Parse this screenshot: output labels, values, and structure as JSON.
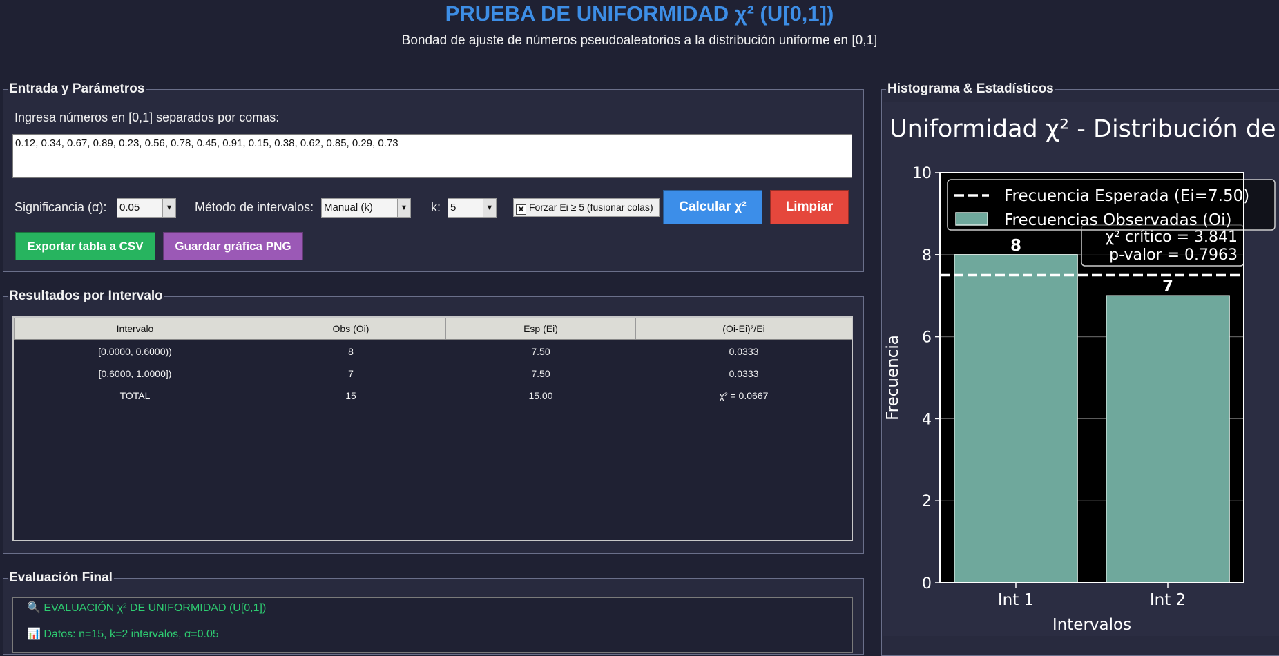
{
  "header": {
    "title": "PRUEBA DE UNIFORMIDAD χ² (U[0,1])",
    "subtitle": "Bondad de ajuste de números pseudoaleatorios a la distribución uniforme en [0,1]"
  },
  "input_panel": {
    "legend": "Entrada y Parámetros",
    "prompt": "Ingresa números en [0,1] separados por comas:",
    "numbers": "0.12, 0.34, 0.67, 0.89, 0.23, 0.56, 0.78, 0.45, 0.91, 0.15, 0.38, 0.62, 0.85, 0.29, 0.73",
    "alpha_label": "Significancia (α):",
    "alpha_value": "0.05",
    "method_label": "Método de intervalos:",
    "method_value": "Manual (k)",
    "k_label": "k:",
    "k_value": "5",
    "merge_checkbox_label": "Forzar Ei ≥ 5 (fusionar colas)",
    "merge_checked_glyph": "✕",
    "calc_button": "Calcular χ²",
    "clear_button": "Limpiar",
    "export_csv_button": "Exportar tabla a CSV",
    "save_png_button": "Guardar gráfica PNG"
  },
  "results_panel": {
    "legend": "Resultados por Intervalo",
    "columns": [
      "Intervalo",
      "Obs (Oi)",
      "Esp (Ei)",
      "(Oi-Ei)²/Ei"
    ],
    "rows": [
      [
        "[0.0000, 0.6000))",
        "8",
        "7.50",
        "0.0333"
      ],
      [
        "[0.6000, 1.0000])",
        "7",
        "7.50",
        "0.0333"
      ],
      [
        "TOTAL",
        "15",
        "15.00",
        "χ² = 0.0667"
      ]
    ]
  },
  "eval_panel": {
    "legend": "Evaluación Final",
    "line1": "EVALUACIÓN χ² DE UNIFORMIDAD (U[0,1])",
    "line2": "Datos: n=15, k=2 intervalos, α=0.05"
  },
  "hist_panel": {
    "legend": "Histograma & Estadísticos"
  },
  "chart_data": {
    "type": "bar",
    "title": "Uniformidad χ² - Distribución de",
    "xlabel": "Intervalos",
    "ylabel": "Frecuencia",
    "categories": [
      "Int 1",
      "Int 2"
    ],
    "series": [
      {
        "name": "Frecuencias Observadas (Oi)",
        "values": [
          8,
          7
        ]
      }
    ],
    "expected_line": {
      "name": "Frecuencia Esperada (Ei=7.50)",
      "value": 7.5
    },
    "data_labels": [
      "8",
      "7"
    ],
    "ylim": [
      0,
      10
    ],
    "yticks": [
      0,
      2,
      4,
      6,
      8,
      10
    ],
    "grid": true,
    "legend_position": "top-right",
    "stats_box": [
      "χ² crítico = 3.841",
      "p-valor = 0.7963"
    ],
    "colors": {
      "bar": "#6fa89c",
      "plot_bg": "#000000",
      "expected": "#ffffff"
    }
  }
}
